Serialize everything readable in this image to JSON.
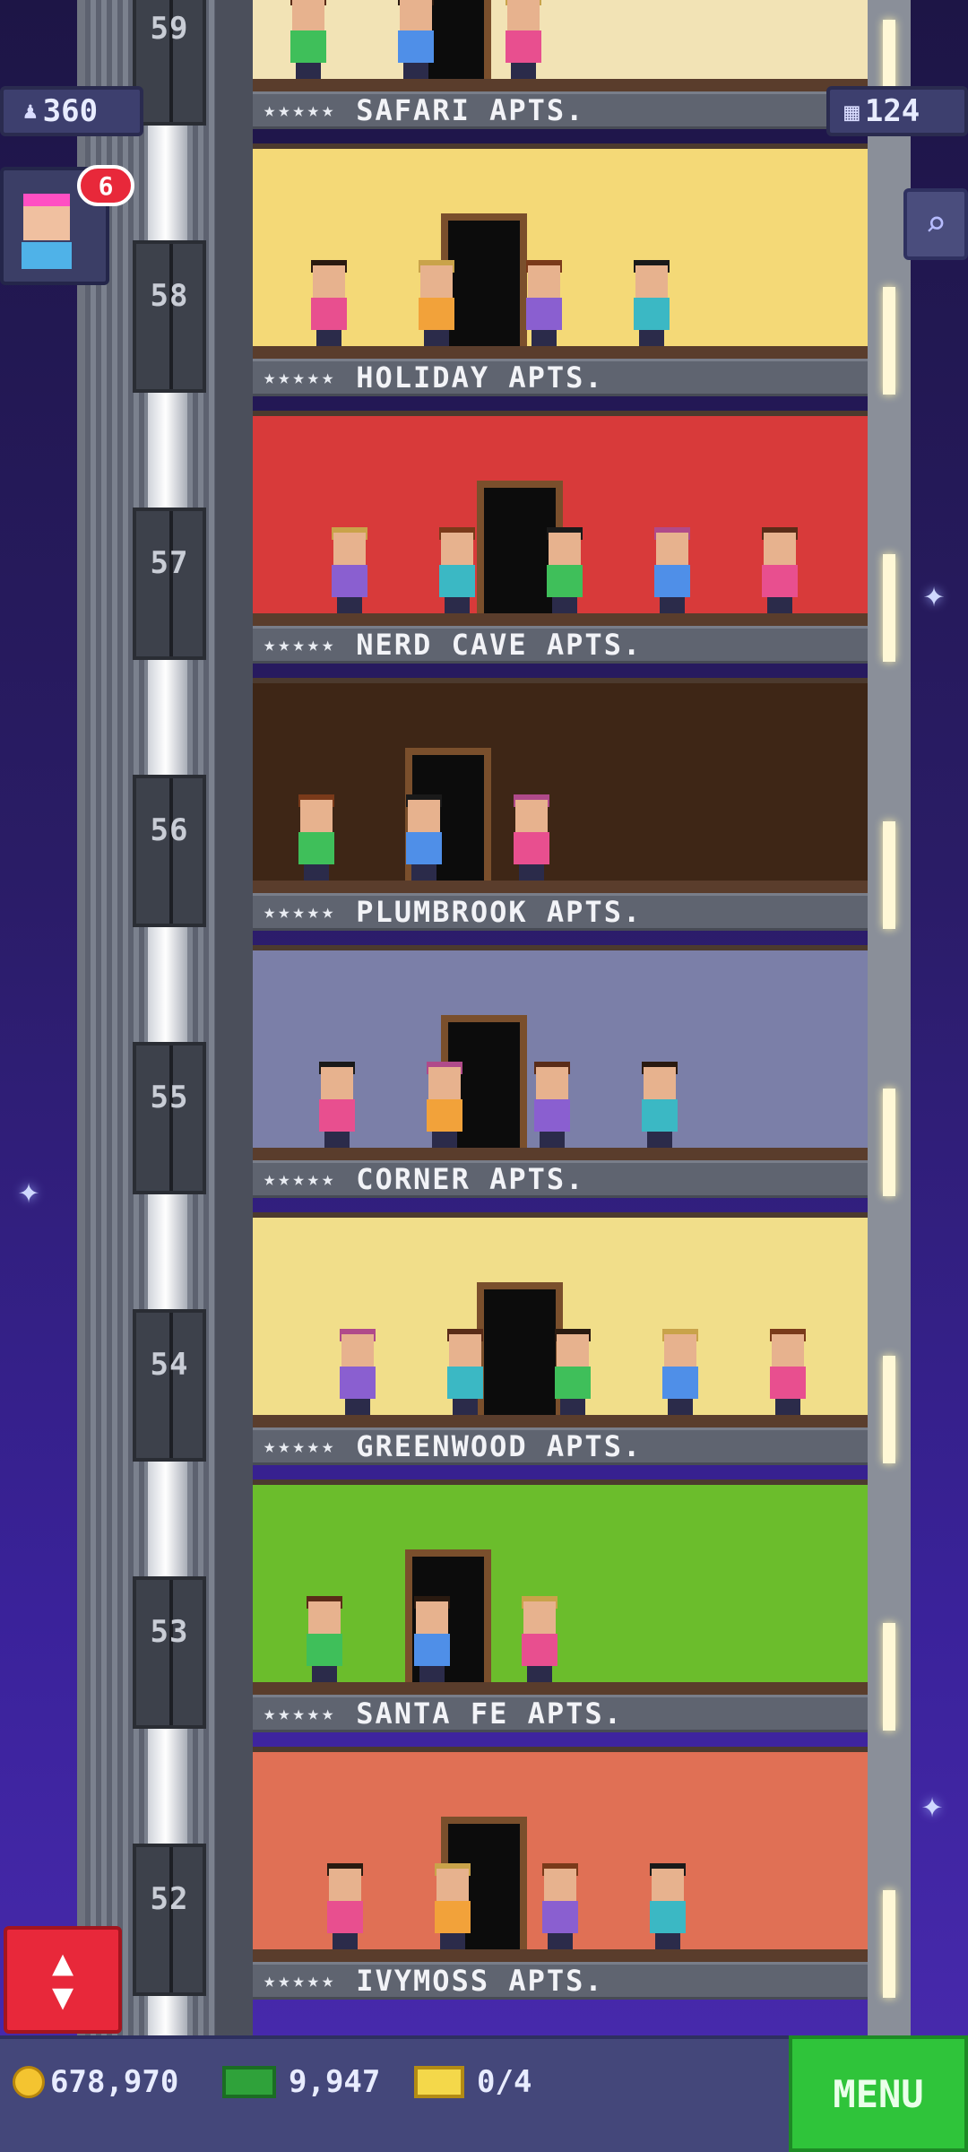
{
  "hud": {
    "population": "360",
    "floors_count": "124",
    "notification_badge": "6",
    "coins": "678,970",
    "bux": "9,947",
    "tickets": "0/4",
    "menu_label": "MENU"
  },
  "icons": {
    "population": "person-icon",
    "floors": "building-icon",
    "search": "magnifier-icon",
    "elevator": "up-down-arrows-icon",
    "coins": "coin-icon",
    "bux": "cash-icon",
    "tickets": "ticket-icon"
  },
  "floors": [
    {
      "number": "59",
      "label": "SAFARI APTS.",
      "stars": "★★★★★",
      "wall": "#f2e3b5"
    },
    {
      "number": "58",
      "label": "HOLIDAY APTS.",
      "stars": "★★★★★",
      "wall": "#f4d977"
    },
    {
      "number": "57",
      "label": "NERD CAVE APTS.",
      "stars": "★★★★★",
      "wall": "#d83a3a"
    },
    {
      "number": "56",
      "label": "PLUMBROOK APTS.",
      "stars": "★★★★★",
      "wall": "#3e2616"
    },
    {
      "number": "55",
      "label": "CORNER APTS.",
      "stars": "★★★★★",
      "wall": "#7b7fa8"
    },
    {
      "number": "54",
      "label": "GREENWOOD APTS.",
      "stars": "★★★★★",
      "wall": "#f1de8a"
    },
    {
      "number": "53",
      "label": "SANTA FE APTS.",
      "stars": "★★★★★",
      "wall": "#6bbd2c"
    },
    {
      "number": "52",
      "label": "IVYMOSS APTS.",
      "stars": "★★★★★",
      "wall": "#e07055"
    }
  ]
}
